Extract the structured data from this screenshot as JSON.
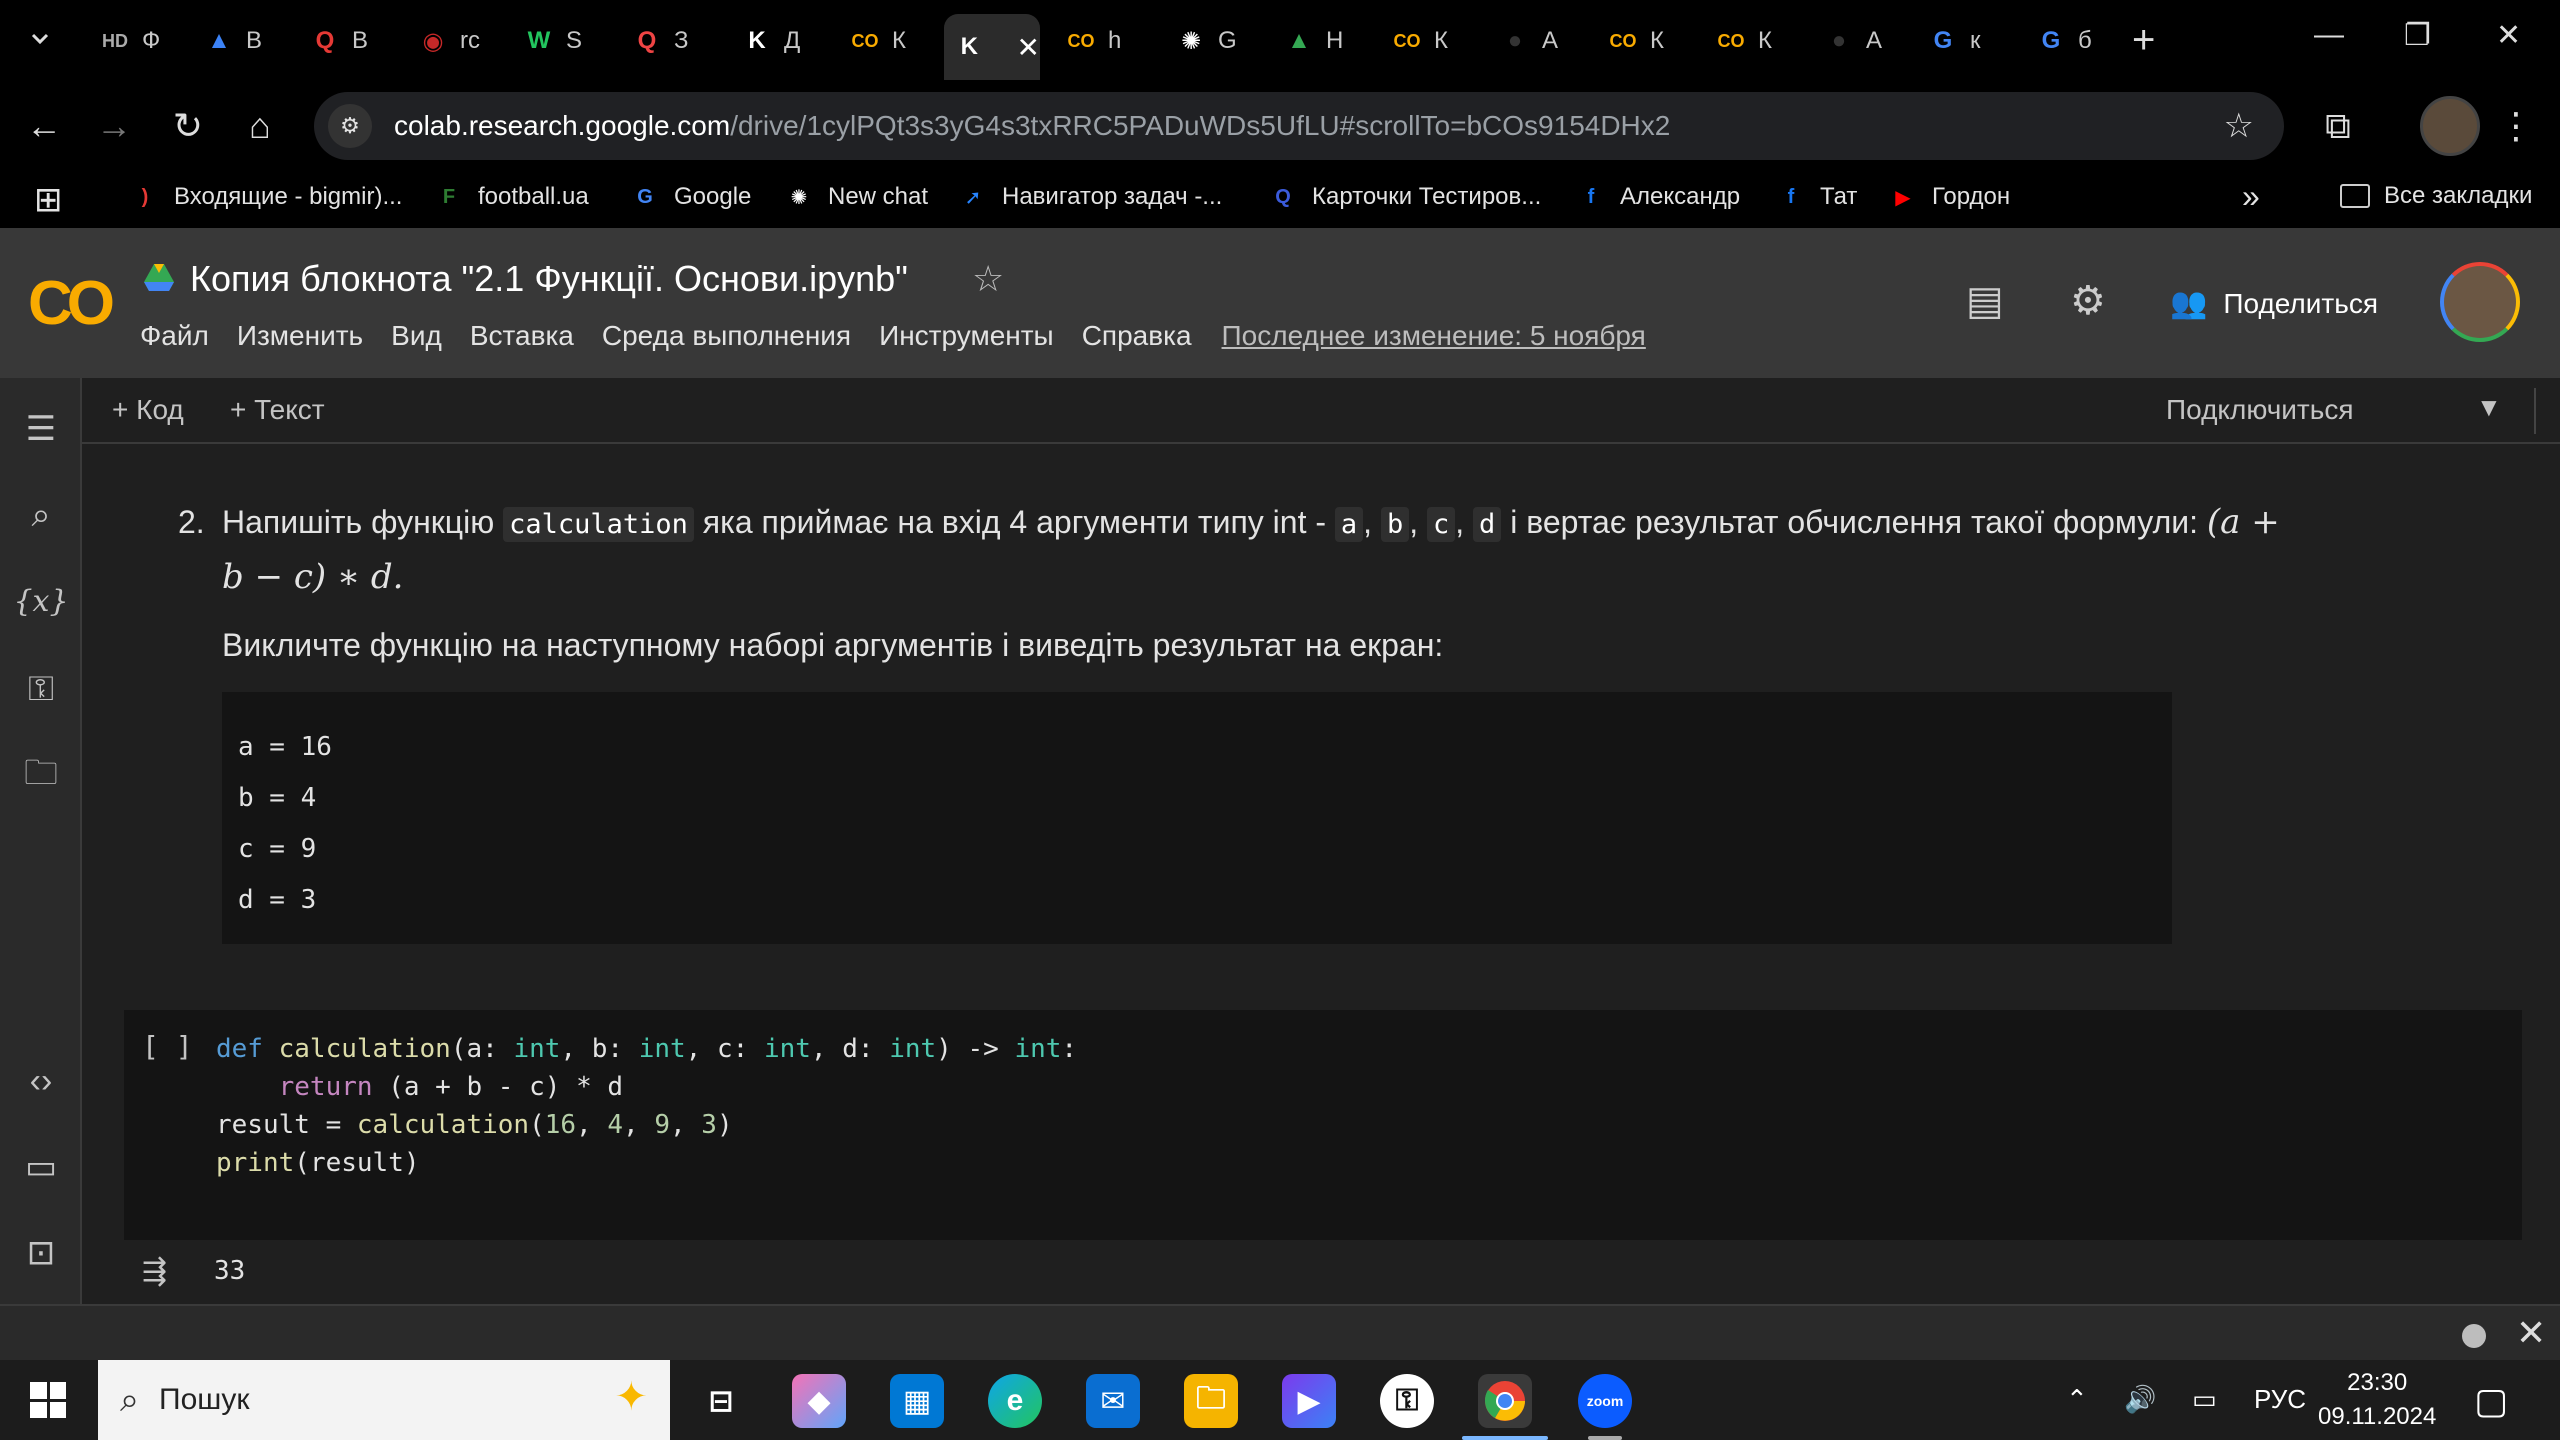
{
  "browser": {
    "tabs": [
      {
        "icon": "hd-icon",
        "glyph": "HD",
        "label": "Ф",
        "color": "#aaaaaa"
      },
      {
        "icon": "triangle-icon",
        "glyph": "▲",
        "label": "В",
        "color": "#3b82f6"
      },
      {
        "icon": "q-red-icon",
        "glyph": "Q",
        "label": "В",
        "color": "#e53935"
      },
      {
        "icon": "rozetka-icon",
        "glyph": "◉",
        "label": "rc",
        "color": "#c62828"
      },
      {
        "icon": "w-icon",
        "glyph": "W",
        "label": "S",
        "color": "#22c55e"
      },
      {
        "icon": "q-search-icon",
        "glyph": "Q",
        "label": "З",
        "color": "#ef4444"
      },
      {
        "icon": "k-icon",
        "glyph": "K",
        "label": "Д",
        "color": "#ffffff"
      },
      {
        "icon": "colab-icon",
        "glyph": "CO",
        "label": "К",
        "color": "#f9ab00"
      },
      {
        "icon": "k-icon",
        "glyph": "K",
        "label": "",
        "color": "#ffffff",
        "active": true
      },
      {
        "icon": "colab-icon",
        "glyph": "CO",
        "label": "h",
        "color": "#f9ab00"
      },
      {
        "icon": "openai-icon",
        "glyph": "✺",
        "label": "G",
        "color": "#ffffff"
      },
      {
        "icon": "drive-icon",
        "glyph": "▲",
        "label": "Н",
        "color": "#34a853"
      },
      {
        "icon": "colab-icon",
        "glyph": "CO",
        "label": "К",
        "color": "#f9ab00"
      },
      {
        "icon": "github-icon",
        "glyph": "●",
        "label": "А",
        "color": "#333333"
      },
      {
        "icon": "colab-icon",
        "glyph": "CO",
        "label": "К",
        "color": "#f9ab00"
      },
      {
        "icon": "colab-icon",
        "glyph": "CO",
        "label": "К",
        "color": "#f9ab00"
      },
      {
        "icon": "github-icon",
        "glyph": "●",
        "label": "А",
        "color": "#333333"
      },
      {
        "icon": "google-icon",
        "glyph": "G",
        "label": "к",
        "color": "#4285f4"
      },
      {
        "icon": "google-icon",
        "glyph": "G",
        "label": "б",
        "color": "#4285f4"
      }
    ],
    "url_host": "colab.research.google.com",
    "url_path": "/drive/1cylPQt3s3yG4s3txRRC5PADuWDs5UfLU#scrollTo=bCOs9154DHx2",
    "bookmarks": [
      {
        "label": "Входящие - bigmir)...",
        "icon": "bigmir-icon",
        "glyph": ")",
        "color": "#e53935"
      },
      {
        "label": "football.ua",
        "icon": "football-icon",
        "glyph": "F",
        "color": "#2e7d32"
      },
      {
        "label": "Google",
        "icon": "google-icon",
        "glyph": "G",
        "color": "#4285f4"
      },
      {
        "label": "New chat",
        "icon": "openai-icon",
        "glyph": "✺",
        "color": "#ffffff"
      },
      {
        "label": "Навигатор задач -...",
        "icon": "jira-icon",
        "glyph": "➚",
        "color": "#2684ff"
      },
      {
        "label": "Карточки Тестиров...",
        "icon": "q-icon",
        "glyph": "Q",
        "color": "#3b5bdb"
      },
      {
        "label": "Александр",
        "icon": "facebook-icon",
        "glyph": "f",
        "color": "#1877f2"
      },
      {
        "label": "Тат",
        "icon": "facebook-icon",
        "glyph": "f",
        "color": "#1877f2"
      },
      {
        "label": "Гордон",
        "icon": "youtube-icon",
        "glyph": "▶",
        "color": "#ff0000"
      }
    ],
    "all_bookmarks": "Все закладки"
  },
  "colab": {
    "logo": "CO",
    "title": "Копия блокнота \"2.1 Функції. Основи.ipynb\"",
    "menu": [
      "Файл",
      "Изменить",
      "Вид",
      "Вставка",
      "Среда выполнения",
      "Инструменты",
      "Справка"
    ],
    "last_edit": "Последнее изменение: 5 ноября",
    "share": "Поделиться",
    "add_code": "+ Код",
    "add_text": "+ Текст",
    "connect": "Подключиться"
  },
  "notebook": {
    "task_number": "2.",
    "task_text_1": "Напишіть функцію",
    "task_fn": "calculation",
    "task_text_2": "яка приймає на вхід 4 аргументи типу int -",
    "arg_a": "a",
    "arg_b": "b",
    "arg_c": "c",
    "arg_d": "d",
    "task_text_3": "і вертає результат обчислення такої",
    "task_text_4": "формули:",
    "formula": "(a + b − c) ∗ d.",
    "task_text_5": "Викличте функцію на наступному наборі аргументів і виведіть результат на екран:",
    "args_block": [
      "a = 16",
      "b = 4",
      "c = 9",
      "d = 3"
    ],
    "run_bracket": "[ ]",
    "code_lines": [
      "def calculation(a: int, b: int, c: int, d: int) -> int:",
      "    return (a + b - c) * d",
      "result = calculation(16, 4, 9, 3)",
      "print(result)"
    ],
    "output": "33"
  },
  "taskbar": {
    "search_placeholder": "Пошук",
    "lang": "РУС",
    "time": "23:30",
    "date": "09.11.2024"
  }
}
